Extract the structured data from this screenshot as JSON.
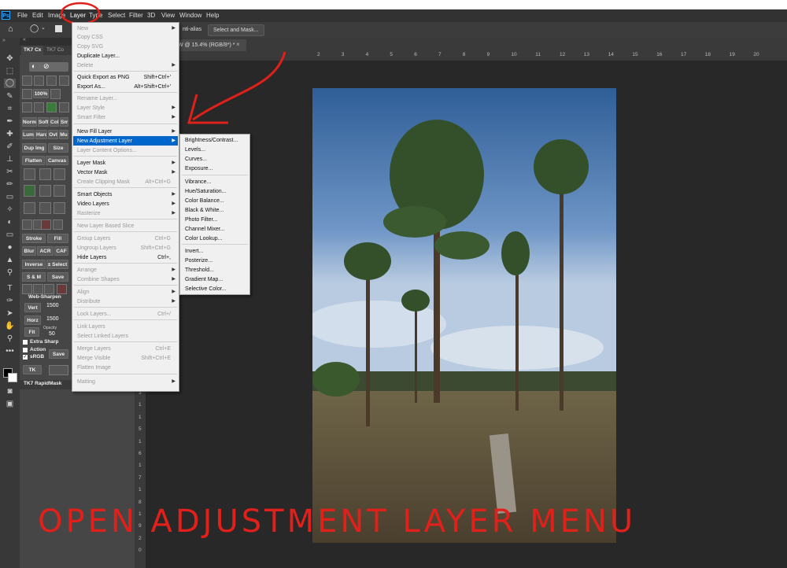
{
  "app": {
    "logo": "Ps"
  },
  "menubar": {
    "items": [
      "File",
      "Edit",
      "Image",
      "Layer",
      "Type",
      "Select",
      "Filter",
      "3D",
      "View",
      "Window",
      "Help"
    ]
  },
  "options": {
    "antialias_label": "nti-alias",
    "select_mask_label": "Select and Mask..."
  },
  "doc_tab": {
    "title": "W @ 15.4% (RGB/8*) *",
    "close": "×"
  },
  "ruler": {
    "h": [
      "2",
      "3",
      "4",
      "5",
      "6",
      "7",
      "8",
      "9",
      "10",
      "11",
      "12",
      "13",
      "14",
      "15",
      "16",
      "17",
      "18",
      "19",
      "20"
    ],
    "v": [
      "3",
      "1",
      "1",
      "5",
      "1",
      "6",
      "1",
      "7",
      "1",
      "8",
      "1",
      "9",
      "2",
      "0"
    ]
  },
  "panel": {
    "tab1": "TK7 Cx",
    "tab2": "TK7 Co",
    "zoom": "100%",
    "rows": {
      "r1": [
        "Norm",
        "Soft",
        "Col",
        "Smc"
      ],
      "r2": [
        "Lum",
        "Hard",
        "Ovl",
        "Mu"
      ],
      "r3": [
        "Dup Img",
        "Size"
      ],
      "r4": [
        "Flatten",
        "Canvas"
      ],
      "stroke": "Stroke",
      "fill": "Fill",
      "blur": "Blur",
      "acr": "ACR",
      "caf": "CAF",
      "inverse": "Inverse",
      "select": "± Select",
      "sm": "S & M",
      "save": "Save"
    },
    "websharpen": {
      "title": "Web-Sharpen",
      "vert": "Vert",
      "vert_val": "1500",
      "horz": "Horz",
      "horz_val": "1500",
      "fit": "Fit",
      "opacity": "Opacity",
      "opacity_val": "50",
      "extra_sharp": "Extra Sharp",
      "action": "Action",
      "srgb": "sRGB",
      "save": "Save",
      "tk": "TK"
    },
    "rapidmask": "TK7 RapidMask"
  },
  "layer_menu": {
    "items": [
      {
        "label": "New",
        "disabled": true,
        "arrow": true
      },
      {
        "label": "Copy CSS",
        "disabled": true
      },
      {
        "label": "Copy SVG",
        "disabled": true
      },
      {
        "label": "Duplicate Layer..."
      },
      {
        "label": "Delete",
        "disabled": true,
        "arrow": true
      },
      {
        "label": "Quick Export as PNG",
        "shortcut": "Shift+Ctrl+'"
      },
      {
        "label": "Export As...",
        "shortcut": "Alt+Shift+Ctrl+'"
      },
      {
        "label": "Rename Layer...",
        "disabled": true
      },
      {
        "label": "Layer Style",
        "disabled": true,
        "arrow": true
      },
      {
        "label": "Smart Filter",
        "disabled": true,
        "arrow": true
      },
      {
        "label": "New Fill Layer",
        "arrow": true
      },
      {
        "label": "New Adjustment Layer",
        "arrow": true,
        "highlight": true
      },
      {
        "label": "Layer Content Options...",
        "disabled": true
      },
      {
        "label": "Layer Mask",
        "arrow": true
      },
      {
        "label": "Vector Mask",
        "arrow": true
      },
      {
        "label": "Create Clipping Mask",
        "disabled": true,
        "shortcut": "Alt+Ctrl+G"
      },
      {
        "label": "Smart Objects",
        "arrow": true
      },
      {
        "label": "Video Layers",
        "arrow": true
      },
      {
        "label": "Rasterize",
        "disabled": true,
        "arrow": true
      },
      {
        "label": "New Layer Based Slice",
        "disabled": true
      },
      {
        "label": "Group Layers",
        "disabled": true,
        "shortcut": "Ctrl+G"
      },
      {
        "label": "Ungroup Layers",
        "disabled": true,
        "shortcut": "Shift+Ctrl+G"
      },
      {
        "label": "Hide Layers",
        "shortcut": "Ctrl+,"
      },
      {
        "label": "Arrange",
        "disabled": true,
        "arrow": true
      },
      {
        "label": "Combine Shapes",
        "disabled": true,
        "arrow": true
      },
      {
        "label": "Align",
        "disabled": true,
        "arrow": true
      },
      {
        "label": "Distribute",
        "disabled": true,
        "arrow": true
      },
      {
        "label": "Lock Layers...",
        "disabled": true,
        "shortcut": "Ctrl+/"
      },
      {
        "label": "Link Layers",
        "disabled": true
      },
      {
        "label": "Select Linked Layers",
        "disabled": true
      },
      {
        "label": "Merge Layers",
        "disabled": true,
        "shortcut": "Ctrl+E"
      },
      {
        "label": "Merge Visible",
        "disabled": true,
        "shortcut": "Shift+Ctrl+E"
      },
      {
        "label": "Flatten Image",
        "disabled": true
      },
      {
        "label": "Matting",
        "disabled": true,
        "arrow": true
      }
    ]
  },
  "adjustment_menu": {
    "items": [
      "Brightness/Contrast...",
      "Levels...",
      "Curves...",
      "Exposure...",
      "Vibrance...",
      "Hue/Saturation...",
      "Color Balance...",
      "Black & White...",
      "Photo Filter...",
      "Channel Mixer...",
      "Color Lookup...",
      "Invert...",
      "Posterize...",
      "Threshold...",
      "Gradient Map...",
      "Selective Color..."
    ]
  },
  "annotation": {
    "text": "OPEN ADJUSTMENT LAYER MENU",
    "color": "#e0201a"
  }
}
